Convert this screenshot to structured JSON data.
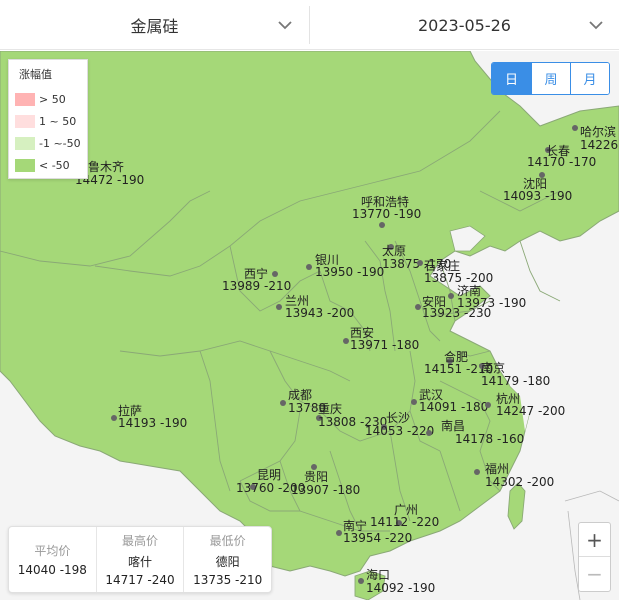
{
  "header": {
    "commodity": "金属硅",
    "date": "2023-05-26"
  },
  "legend": {
    "title": "涨幅值",
    "items": [
      {
        "label": "> 50",
        "color": "#ffb3b3"
      },
      {
        "label": "1 ~ 50",
        "color": "#ffdede"
      },
      {
        "label": "-1 ~-50",
        "color": "#d6f0c0"
      },
      {
        "label": "< -50",
        "color": "#a5d878"
      }
    ]
  },
  "period": {
    "options": [
      "日",
      "周",
      "月"
    ],
    "active": "日"
  },
  "map": {
    "fill_color": "#a5d878",
    "border_color": "#8aa876",
    "background": "#f4f4f4",
    "cities": [
      {
        "name": "哈尔滨",
        "value": "14226"
      },
      {
        "name": "长春",
        "value": "14170 -170"
      },
      {
        "name": "沈阳",
        "value": "14093 -190"
      },
      {
        "name": "乌鲁木齐",
        "value": "14472 -190"
      },
      {
        "name": "呼和浩特",
        "value": "13770 -190"
      },
      {
        "name": "银川",
        "value": "13950 -190"
      },
      {
        "name": "太原",
        "value": "13875 -170"
      },
      {
        "name": "石家庄",
        "value": "13875 -200"
      },
      {
        "name": "西宁",
        "value": "13989 -210"
      },
      {
        "name": "兰州",
        "value": "13943 -200"
      },
      {
        "name": "济南",
        "value": "13973 -190"
      },
      {
        "name": "安阳",
        "value": "13923 -230"
      },
      {
        "name": "西安",
        "value": "13971 -180"
      },
      {
        "name": "合肥",
        "value": "14151 -210"
      },
      {
        "name": "南京",
        "value": "14179 -180"
      },
      {
        "name": "拉萨",
        "value": "14193 -190"
      },
      {
        "name": "成都",
        "value": "13780"
      },
      {
        "name": "重庆",
        "value": "13808 -230"
      },
      {
        "name": "武汉",
        "value": "14091 -180"
      },
      {
        "name": "杭州",
        "value": "14247 -200"
      },
      {
        "name": "长沙",
        "value": "14053 -220"
      },
      {
        "name": "南昌",
        "value": "14178 -160"
      },
      {
        "name": "昆明",
        "value": "13760 -200"
      },
      {
        "name": "贵阳",
        "value": "13907 -180"
      },
      {
        "name": "福州",
        "value": "14302 -200"
      },
      {
        "name": "广州",
        "value": "14112 -220"
      },
      {
        "name": "南宁",
        "value": "13954 -220"
      },
      {
        "name": "海口",
        "value": "14092 -190"
      }
    ]
  },
  "stats": {
    "average": {
      "label": "平均价",
      "value": "14040 -198"
    },
    "highest": {
      "label": "最高价",
      "city": "喀什",
      "value": "14717 -240"
    },
    "lowest": {
      "label": "最低价",
      "city": "德阳",
      "value": "13735 -210"
    }
  },
  "zoom": {
    "in": "+",
    "out": "−"
  }
}
